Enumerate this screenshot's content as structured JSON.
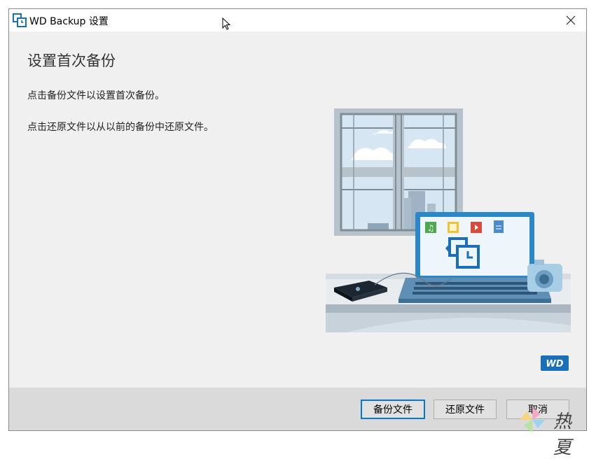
{
  "window": {
    "title": "WD Backup 设置",
    "close_icon": "close-icon",
    "app_icon": "wd-backup-app-icon"
  },
  "main": {
    "heading": "设置首次备份",
    "line1": "点击备份文件以设置首次备份。",
    "line2": "点击还原文件以从以前的备份中还原文件。"
  },
  "brand": {
    "logo_text": "WD",
    "color": "#1a6fb8"
  },
  "footer": {
    "backup_label": "备份文件",
    "restore_label": "还原文件",
    "cancel_label": "取消"
  },
  "watermark": {
    "text": "热夏"
  },
  "colors": {
    "accent": "#0078d7",
    "window_bg": "#f0f0f0",
    "footer_bg": "#dadada"
  }
}
